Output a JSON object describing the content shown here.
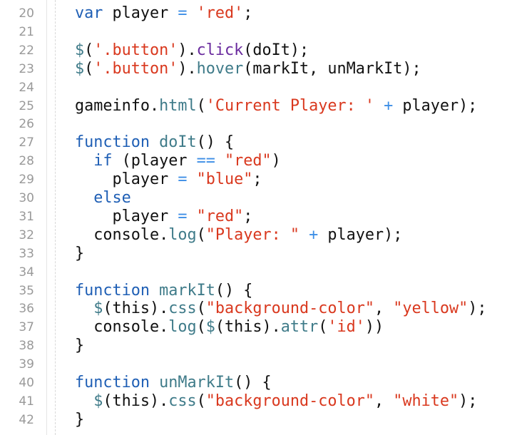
{
  "editor": {
    "lines": [
      {
        "n": "20",
        "tokens": [
          [
            "kw",
            "var"
          ],
          [
            "pl",
            " player "
          ],
          [
            "op",
            "="
          ],
          [
            "pl",
            " "
          ],
          [
            "str",
            "'red'"
          ],
          [
            "pl",
            ";"
          ]
        ]
      },
      {
        "n": "21",
        "tokens": []
      },
      {
        "n": "22",
        "tokens": [
          [
            "fn",
            "$"
          ],
          [
            "pl",
            "("
          ],
          [
            "str",
            "'.button'"
          ],
          [
            "pl",
            ")."
          ],
          [
            "purple",
            "click"
          ],
          [
            "pl",
            "(doIt);"
          ]
        ]
      },
      {
        "n": "23",
        "tokens": [
          [
            "fn",
            "$"
          ],
          [
            "pl",
            "("
          ],
          [
            "str",
            "'.button'"
          ],
          [
            "pl",
            ")."
          ],
          [
            "meth",
            "hover"
          ],
          [
            "pl",
            "(markIt, unMarkIt);"
          ]
        ]
      },
      {
        "n": "24",
        "tokens": []
      },
      {
        "n": "25",
        "tokens": [
          [
            "pl",
            "gameinfo."
          ],
          [
            "meth",
            "html"
          ],
          [
            "pl",
            "("
          ],
          [
            "str",
            "'Current Player: '"
          ],
          [
            "pl",
            " "
          ],
          [
            "op",
            "+"
          ],
          [
            "pl",
            " player);"
          ]
        ]
      },
      {
        "n": "26",
        "tokens": []
      },
      {
        "n": "27",
        "tokens": [
          [
            "kw",
            "function"
          ],
          [
            "pl",
            " "
          ],
          [
            "fn",
            "doIt"
          ],
          [
            "pl",
            "() {"
          ]
        ]
      },
      {
        "n": "28",
        "tokens": [
          [
            "pl",
            "  "
          ],
          [
            "kw",
            "if"
          ],
          [
            "pl",
            " (player "
          ],
          [
            "op",
            "=="
          ],
          [
            "pl",
            " "
          ],
          [
            "str",
            "\"red\""
          ],
          [
            "pl",
            ")"
          ]
        ]
      },
      {
        "n": "29",
        "tokens": [
          [
            "pl",
            "    player "
          ],
          [
            "op",
            "="
          ],
          [
            "pl",
            " "
          ],
          [
            "str",
            "\"blue\""
          ],
          [
            "pl",
            ";"
          ]
        ]
      },
      {
        "n": "30",
        "tokens": [
          [
            "pl",
            "  "
          ],
          [
            "kw",
            "else"
          ]
        ]
      },
      {
        "n": "31",
        "tokens": [
          [
            "pl",
            "    player "
          ],
          [
            "op",
            "="
          ],
          [
            "pl",
            " "
          ],
          [
            "str",
            "\"red\""
          ],
          [
            "pl",
            ";"
          ]
        ]
      },
      {
        "n": "32",
        "tokens": [
          [
            "pl",
            "  console."
          ],
          [
            "meth",
            "log"
          ],
          [
            "pl",
            "("
          ],
          [
            "str",
            "\"Player: \""
          ],
          [
            "pl",
            " "
          ],
          [
            "op",
            "+"
          ],
          [
            "pl",
            " player);"
          ]
        ]
      },
      {
        "n": "33",
        "tokens": [
          [
            "pl",
            "}"
          ]
        ]
      },
      {
        "n": "34",
        "tokens": []
      },
      {
        "n": "35",
        "tokens": [
          [
            "kw",
            "function"
          ],
          [
            "pl",
            " "
          ],
          [
            "fn",
            "markIt"
          ],
          [
            "pl",
            "() {"
          ]
        ]
      },
      {
        "n": "36",
        "tokens": [
          [
            "pl",
            "  "
          ],
          [
            "fn",
            "$"
          ],
          [
            "pl",
            "(this)."
          ],
          [
            "meth",
            "css"
          ],
          [
            "pl",
            "("
          ],
          [
            "str",
            "\"background-color\""
          ],
          [
            "pl",
            ", "
          ],
          [
            "str",
            "\"yellow\""
          ],
          [
            "pl",
            ");"
          ]
        ]
      },
      {
        "n": "37",
        "tokens": [
          [
            "pl",
            "  console."
          ],
          [
            "meth",
            "log"
          ],
          [
            "pl",
            "("
          ],
          [
            "fn",
            "$"
          ],
          [
            "pl",
            "(this)."
          ],
          [
            "meth",
            "attr"
          ],
          [
            "pl",
            "("
          ],
          [
            "str",
            "'id'"
          ],
          [
            "pl",
            "))"
          ]
        ]
      },
      {
        "n": "38",
        "tokens": [
          [
            "pl",
            "}"
          ]
        ]
      },
      {
        "n": "39",
        "tokens": []
      },
      {
        "n": "40",
        "tokens": [
          [
            "kw",
            "function"
          ],
          [
            "pl",
            " "
          ],
          [
            "fn",
            "unMarkIt"
          ],
          [
            "pl",
            "() {"
          ]
        ]
      },
      {
        "n": "41",
        "tokens": [
          [
            "pl",
            "  "
          ],
          [
            "fn",
            "$"
          ],
          [
            "pl",
            "(this)."
          ],
          [
            "meth",
            "css"
          ],
          [
            "pl",
            "("
          ],
          [
            "str",
            "\"background-color\""
          ],
          [
            "pl",
            ", "
          ],
          [
            "str",
            "\"white\""
          ],
          [
            "pl",
            ");"
          ]
        ]
      },
      {
        "n": "42",
        "tokens": [
          [
            "pl",
            "}"
          ]
        ]
      }
    ]
  },
  "colors": {
    "keyword": "#1f5fb5",
    "operator": "#3c8ee6",
    "string": "#d9381e",
    "function": "#3f7b89",
    "click": "#6a2b9e",
    "line_number": "#999999"
  }
}
